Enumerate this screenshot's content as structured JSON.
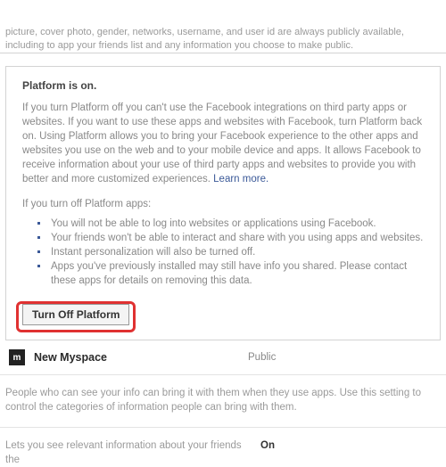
{
  "top": {
    "text": "picture, cover photo, gender, networks, username, and user id are always publicly available, including to app your friends list and any information you choose to make public."
  },
  "platform": {
    "title": "Platform is on.",
    "desc": "If you turn Platform off you can't use the Facebook integrations on third party apps or websites. If you want to use these apps and websites with Facebook, turn Platform back on. Using Platform allows you to bring your Facebook experience to the other apps and websites you use on the web and to your mobile device and apps. It allows Facebook to receive information about your use of third party apps and websites to provide you with better and more customized experiences.",
    "learn_more": "Learn more.",
    "subhead": "If you turn off Platform apps:",
    "bullets": [
      "You will not be able to log into websites or applications using Facebook.",
      "Your friends won't be able to interact and share with you using apps and websites.",
      "Instant personalization will also be turned off.",
      "Apps you've previously installed may still have info you shared. Please contact these apps for details on removing this data."
    ],
    "button": "Turn Off Platform"
  },
  "app": {
    "icon_abbrev": "m",
    "name": "New Myspace",
    "visibility": "Public"
  },
  "info_block": "People who can see your info can bring it with them when they use apps. Use this setting to control the categories of information people can bring with them.",
  "row2": {
    "text": "Lets you see relevant information about your friends the",
    "status": "On"
  }
}
